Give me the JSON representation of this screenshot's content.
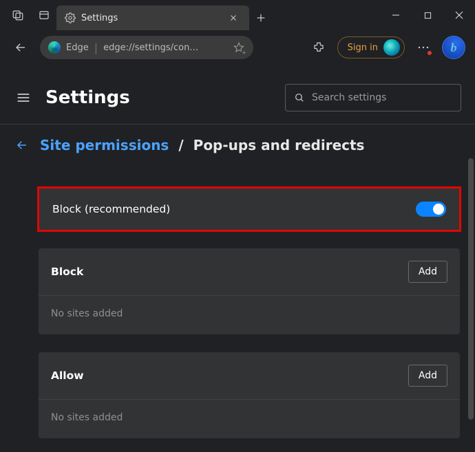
{
  "titlebar": {
    "tab_title": "Settings"
  },
  "toolbar": {
    "brand": "Edge",
    "url_display": "edge://settings/con…",
    "signin_label": "Sign in"
  },
  "header": {
    "title": "Settings",
    "search_placeholder": "Search settings"
  },
  "breadcrumb": {
    "parent": "Site permissions",
    "separator": "/",
    "current": "Pop-ups and redirects"
  },
  "main_toggle": {
    "label": "Block (recommended)",
    "on": true
  },
  "block_section": {
    "title": "Block",
    "add_label": "Add",
    "empty_text": "No sites added"
  },
  "allow_section": {
    "title": "Allow",
    "add_label": "Add",
    "empty_text": "No sites added"
  },
  "colors": {
    "accent_link": "#4aa3ff",
    "toggle_on": "#0a84ff",
    "highlight_border": "#e10600"
  }
}
